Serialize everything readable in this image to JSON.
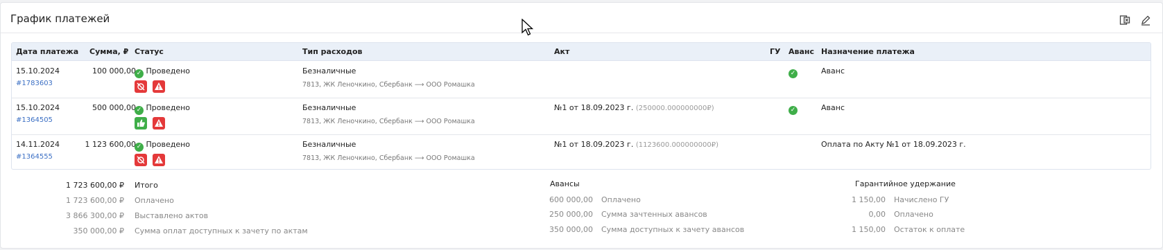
{
  "title": "График платежей",
  "toolbar": {
    "excel_icon": "excel-export-icon",
    "edit_icon": "pencil-icon"
  },
  "table": {
    "columns": [
      "Дата платежа",
      "Сумма, ₽",
      "Статус",
      "Тип расходов",
      "Акт",
      "ГУ",
      "Аванс",
      "Назначение платежа"
    ],
    "rows": [
      {
        "date": "15.10.2024",
        "id": "#1783603",
        "sum": "100 000,00",
        "status": "Проведено",
        "type": "Безналичные",
        "type_sub": "7813, ЖК Леночкино, Сбербанк ⟶ ООО Ромашка",
        "act": "",
        "act_sub": "",
        "avans": true,
        "purpose": "Аванс",
        "badges": [
          "no-tax-icon",
          "warning-icon"
        ]
      },
      {
        "date": "15.10.2024",
        "id": "#1364505",
        "sum": "500 000,00",
        "status": "Проведено",
        "type": "Безналичные",
        "type_sub": "7813, ЖК Леночкино, Сбербанк ⟶ ООО Ромашка",
        "act": "№1 от 18.09.2023 г.",
        "act_sub": "(250000.000000000₽)",
        "avans": true,
        "purpose": "Аванс",
        "badges": [
          "thumb-up-icon",
          "warning-icon"
        ]
      },
      {
        "date": "14.11.2024",
        "id": "#1364555",
        "sum": "1 123 600,00",
        "status": "Проведено",
        "type": "Безналичные",
        "type_sub": "7813, ЖК Леночкино, Сбербанк ⟶ ООО Ромашка",
        "act": "№1 от 18.09.2023 г.",
        "act_sub": "(1123600.000000000₽)",
        "avans": false,
        "purpose": "Оплата по Акту №1 от 18.09.2023 г.",
        "badges": [
          "no-tax-icon",
          "warning-icon"
        ]
      }
    ]
  },
  "totals": {
    "total_value": "1 723 600,00 ₽",
    "total_label": "Итого",
    "paid_value": "1 723 600,00 ₽",
    "paid_label": "Оплачено",
    "acts_value": "3 866 300,00 ₽",
    "acts_label": "Выставлено актов",
    "avail_value": "350 000,00 ₽",
    "avail_label": "Сумма оплат доступных к зачету по актам"
  },
  "advances": {
    "heading": "Авансы",
    "paid_value": "600 000,00",
    "paid_label": "Оплачено",
    "credited_value": "250 000,00",
    "credited_label": "Сумма зачтенных авансов",
    "available_value": "350 000,00",
    "available_label": "Сумма доступных к зачету авансов"
  },
  "guarantee": {
    "heading": "Гарантийное удержание",
    "accrued_value": "1 150,00",
    "accrued_label": "Начислено ГУ",
    "paid_value": "0,00",
    "paid_label": "Оплачено",
    "remaining_value": "1 150,00",
    "remaining_label": "Остаток к оплате"
  },
  "colors": {
    "success": "#3fae49",
    "danger": "#e4393a",
    "link": "#3b6fc4",
    "header_bg": "#eaf0f8"
  }
}
